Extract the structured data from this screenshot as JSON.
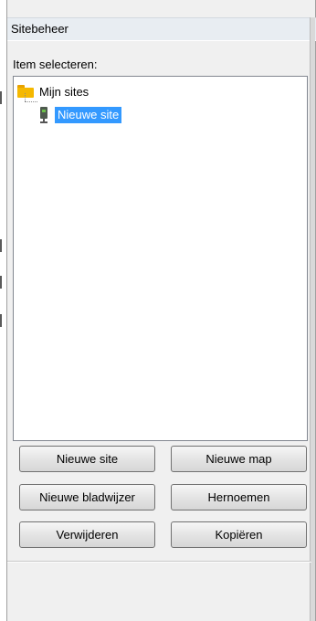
{
  "window": {
    "title": "Sitebeheer"
  },
  "selector": {
    "label": "Item selecteren:",
    "tree": {
      "root": {
        "label": "Mijn sites",
        "icon": "folder-icon"
      },
      "children": [
        {
          "label": "Nieuwe site",
          "icon": "server-icon",
          "selected": true
        }
      ]
    }
  },
  "buttons": {
    "new_site": "Nieuwe site",
    "new_folder": "Nieuwe map",
    "new_bookmark": "Nieuwe bladwijzer",
    "rename": "Hernoemen",
    "delete": "Verwijderen",
    "copy": "Kopiëren"
  },
  "colors": {
    "selection": "#3399ff",
    "folder": "#f5b800",
    "window_bg": "#f0f0f0"
  }
}
